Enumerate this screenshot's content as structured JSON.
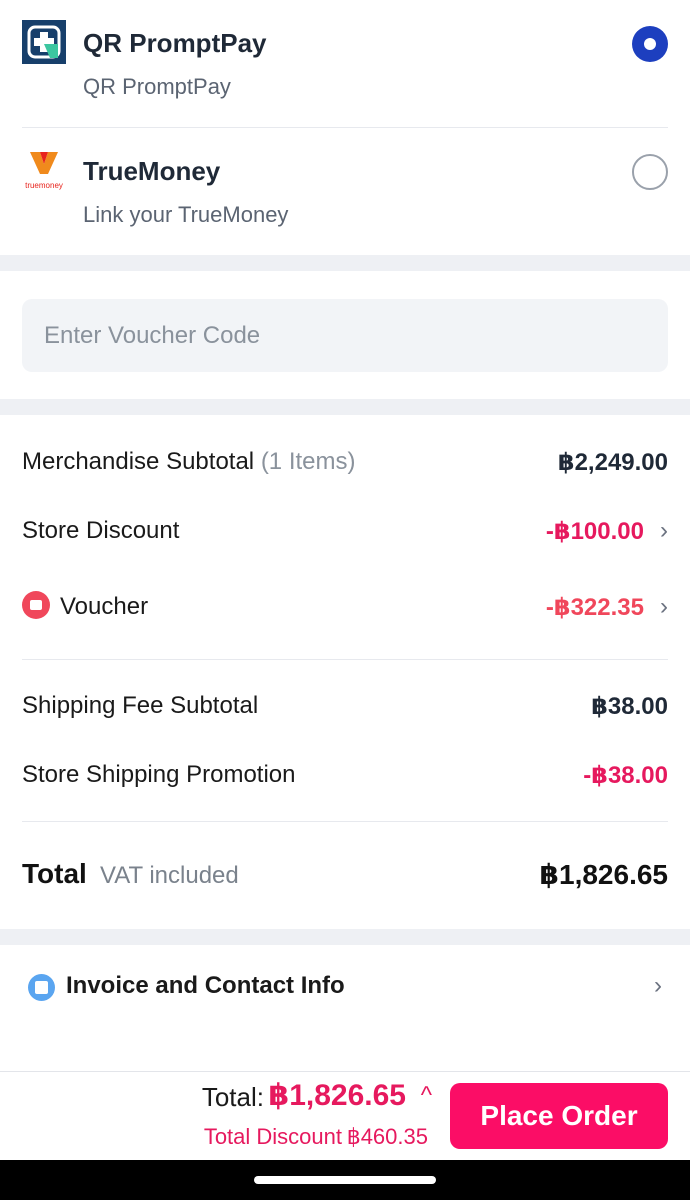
{
  "payment_methods": [
    {
      "title": "QR PromptPay",
      "subtitle": "QR PromptPay",
      "selected": true,
      "icon": "qr-promptpay-icon",
      "color": "#1d3fbf"
    },
    {
      "title": "TrueMoney",
      "subtitle": "Link your TrueMoney",
      "selected": false,
      "icon": "truemoney-logo",
      "logo_text": "truemoney"
    }
  ],
  "voucher": {
    "placeholder": "Enter Voucher Code"
  },
  "summary": {
    "merchandise": {
      "label": "Merchandise Subtotal",
      "count": "(1 Items)",
      "value": "฿2,249.00"
    },
    "store_discount": {
      "label": "Store Discount",
      "value": "-฿100.00"
    },
    "voucher": {
      "label": "Voucher",
      "value": "-฿322.35"
    },
    "shipping": {
      "label": "Shipping Fee Subtotal",
      "value": "฿38.00"
    },
    "shipping_promo": {
      "label": "Store Shipping Promotion",
      "value": "-฿38.00"
    },
    "total": {
      "label": "Total",
      "vat": "VAT included",
      "value": "฿1,826.65"
    }
  },
  "invoice": {
    "label": "Invoice and Contact Info"
  },
  "bottom": {
    "total_label": "Total:",
    "total_value": "฿1,826.65",
    "discount_label": "Total Discount",
    "discount_value": "฿460.35",
    "place_order": "Place Order"
  },
  "colors": {
    "accent": "#fb0d66",
    "discount": "#e6195e",
    "voucher": "#f0475b",
    "radio_selected": "#1d3fbf"
  }
}
